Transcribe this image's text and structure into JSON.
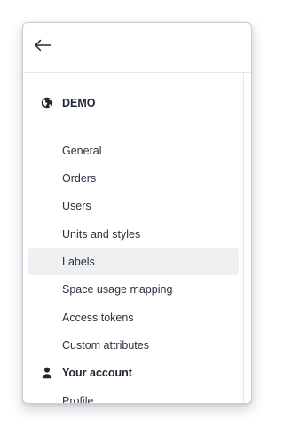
{
  "header": {
    "back_icon": "arrow-left-icon"
  },
  "sections": [
    {
      "title": "DEMO",
      "icon": "globe-icon",
      "items": [
        {
          "label": "General"
        },
        {
          "label": "Orders"
        },
        {
          "label": "Users"
        },
        {
          "label": "Units and styles"
        },
        {
          "label": "Labels",
          "active": true
        },
        {
          "label": "Space usage mapping"
        },
        {
          "label": "Access tokens"
        },
        {
          "label": "Custom attributes"
        }
      ]
    },
    {
      "title": "Your account",
      "icon": "person-icon",
      "items": [
        {
          "label": "Profile"
        }
      ]
    }
  ],
  "colors": {
    "active_background": "#eff0f2",
    "text": "#2b3340",
    "heading": "#1f2733"
  }
}
